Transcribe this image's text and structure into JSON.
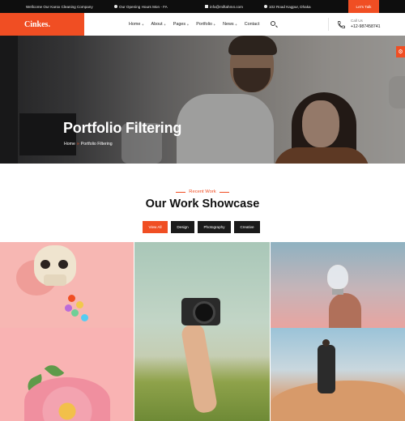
{
  "topbar": {
    "welcome": "Wellcome Our Karox Cleaning Company",
    "hours": "Our Opening Hours Mon - FA",
    "email": "info@miftahm4.com",
    "address": "102 Road Kagpur, Dhaka",
    "cta": "Let's Talk"
  },
  "header": {
    "logo": "Cinkes.",
    "nav": [
      {
        "label": "Home",
        "has_submenu": true
      },
      {
        "label": "About",
        "has_submenu": true
      },
      {
        "label": "Pages",
        "has_submenu": true
      },
      {
        "label": "Portfolio",
        "has_submenu": true
      },
      {
        "label": "News",
        "has_submenu": true
      },
      {
        "label": "Contact",
        "has_submenu": false
      }
    ],
    "submenu_marker": "+",
    "call_label": "Call Us",
    "call_number": "+12-987458741"
  },
  "hero": {
    "title": "Portfolio Filtering",
    "breadcrumb_home": "Home",
    "breadcrumb_sep": "»",
    "breadcrumb_current": "Portfolio Filtering",
    "gear_glyph": "⚙"
  },
  "section": {
    "subtitle": "Recent Work",
    "title": "Our Work Showcase"
  },
  "filters": {
    "items": [
      "View All",
      "Design",
      "Photography",
      "Creative"
    ],
    "active_index": 0
  },
  "colors": {
    "accent": "#f04e23",
    "dark": "#1a1a1a",
    "topbar_bg": "#0e0e0e"
  },
  "gallery": {
    "items": [
      {
        "icon": "skull-photo"
      },
      {
        "icon": "flower-photo"
      },
      {
        "icon": "camera-photo"
      },
      {
        "icon": "lightbulb-photo"
      },
      {
        "icon": "desert-hiker-photo"
      }
    ]
  }
}
